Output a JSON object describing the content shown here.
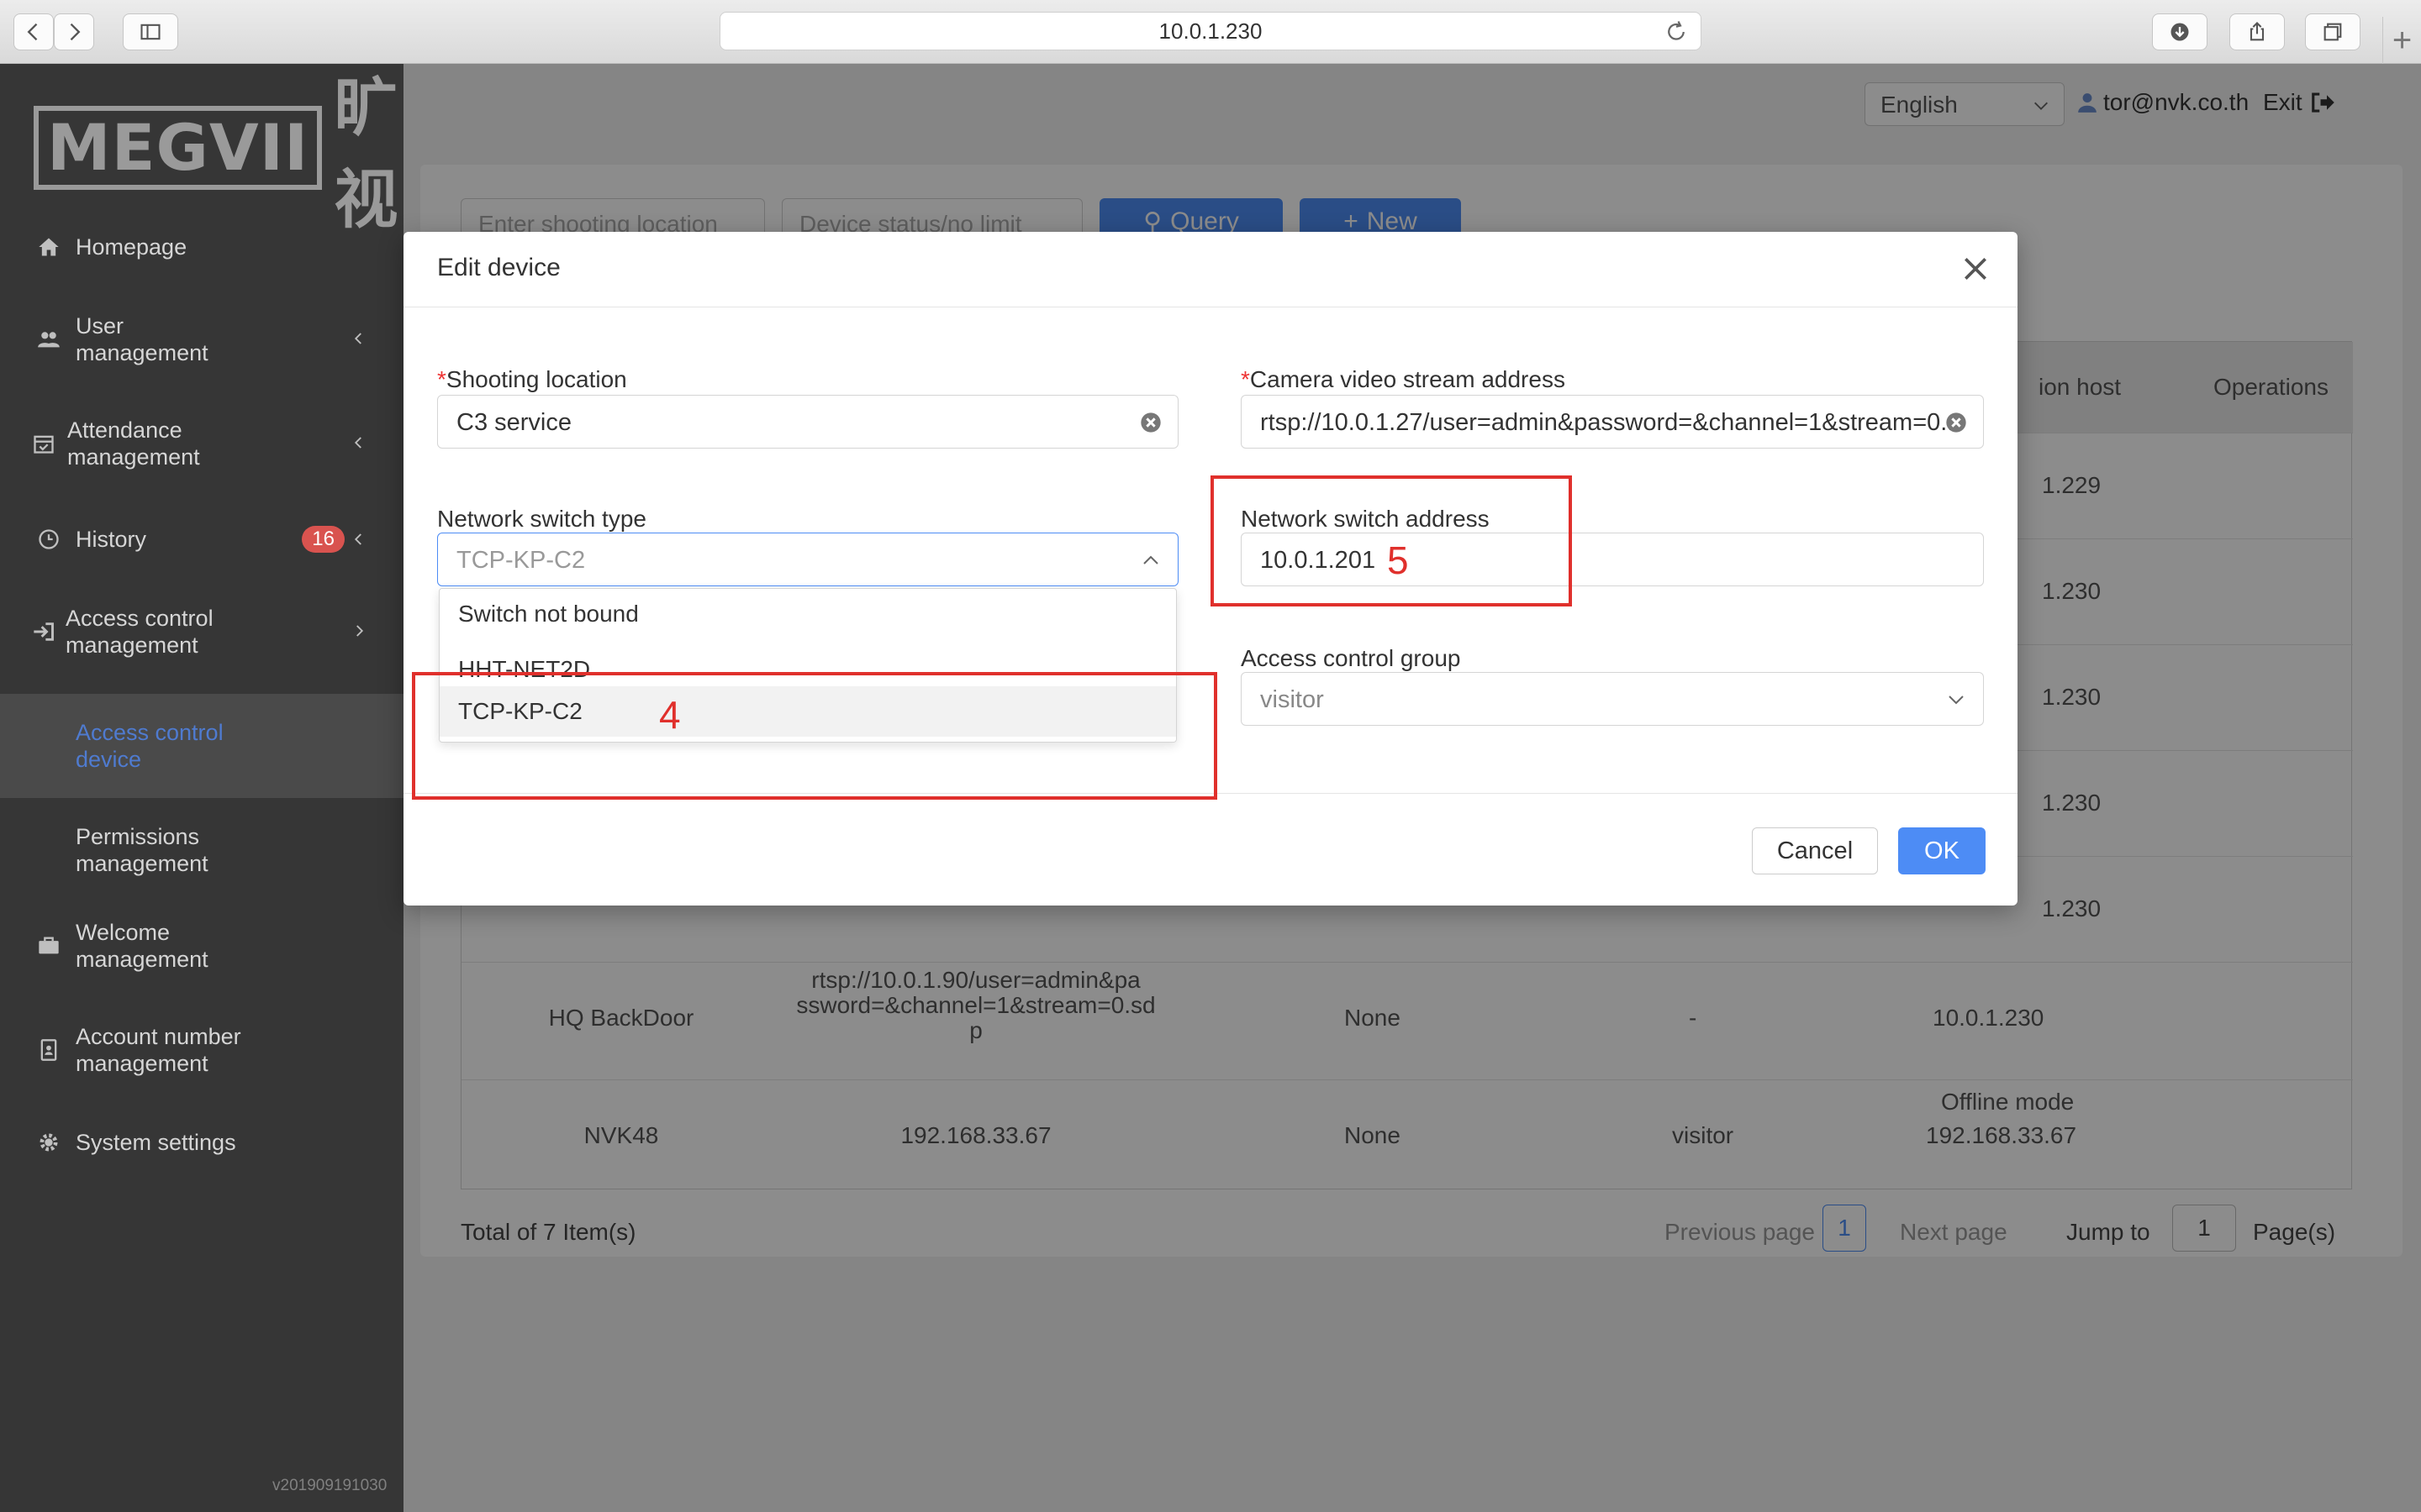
{
  "browser": {
    "url": "10.0.1.230"
  },
  "sidebar": {
    "logo_text": "MEGVII",
    "logo_cn": "旷视",
    "items": [
      {
        "label": "Homepage",
        "icon": "home-icon"
      },
      {
        "label": "User\nmanagement",
        "icon": "users-icon"
      },
      {
        "label": "Attendance\nmanagement",
        "icon": "calendar-icon"
      },
      {
        "label": "History",
        "icon": "clock-icon",
        "badge": "16"
      },
      {
        "label": "Access control\nmanagement",
        "icon": "sign-in-icon"
      },
      {
        "label": "Access control\ndevice",
        "active": true
      },
      {
        "label": "Permissions\nmanagement"
      },
      {
        "label": "Welcome\nmanagement",
        "icon": "briefcase-icon"
      },
      {
        "label": "Account number\nmanagement",
        "icon": "id-badge-icon"
      },
      {
        "label": "System settings",
        "icon": "gear-icon"
      }
    ],
    "version": "v201909191030"
  },
  "topbar": {
    "language": "English",
    "user_email": "tor@nvk.co.th",
    "exit_label": "Exit"
  },
  "filters": {
    "location_placeholder": "Enter shooting location",
    "status_placeholder": "Device status/no limit",
    "query_label": "Query",
    "new_label": "New"
  },
  "table": {
    "visible_headers": [
      "ion host",
      "Operations"
    ],
    "rows": [
      {
        "host": "1.229"
      },
      {
        "host": "1.230"
      },
      {
        "host": "1.230"
      },
      {
        "host": "1.230"
      },
      {
        "host": "1.230"
      },
      {
        "location": "HQ BackDoor",
        "stream": "rtsp://10.0.1.90/user=admin&pa\nssword=&channel=1&stream=0.sd\np",
        "switch": "None",
        "group": "-",
        "host": "10.0.1.230"
      },
      {
        "location": "NVK48",
        "stream": "192.168.33.67",
        "switch": "None",
        "group": "visitor",
        "host_mode": "Offline mode",
        "host": "192.168.33.67"
      }
    ]
  },
  "pagination": {
    "total": "Total of 7 Item(s)",
    "prev": "Previous page",
    "current": "1",
    "next": "Next page",
    "jump_to": "Jump to",
    "jump_value": "1",
    "pages": "Page(s)"
  },
  "modal": {
    "title": "Edit device",
    "shooting_location": {
      "label": "Shooting location",
      "value": "C3 service"
    },
    "camera_stream": {
      "label": "Camera video stream address",
      "value": "rtsp://10.0.1.27/user=admin&password=&channel=1&stream=0.."
    },
    "switch_type": {
      "label": "Network switch type",
      "value": "TCP-KP-C2",
      "options": [
        "Switch not bound",
        "HHT-NET2D",
        "TCP-KP-C2"
      ]
    },
    "switch_address": {
      "label": "Network switch address",
      "value": "10.0.1.201"
    },
    "access_group": {
      "label": "Access control group",
      "value": "visitor"
    },
    "cancel_label": "Cancel",
    "ok_label": "OK"
  },
  "annotations": {
    "step4": "4",
    "step5": "5",
    "color": "#e0302c"
  },
  "colors": {
    "primary": "#4d8cf5",
    "sidebar_bg": "#363636",
    "badge": "#d9534f"
  }
}
